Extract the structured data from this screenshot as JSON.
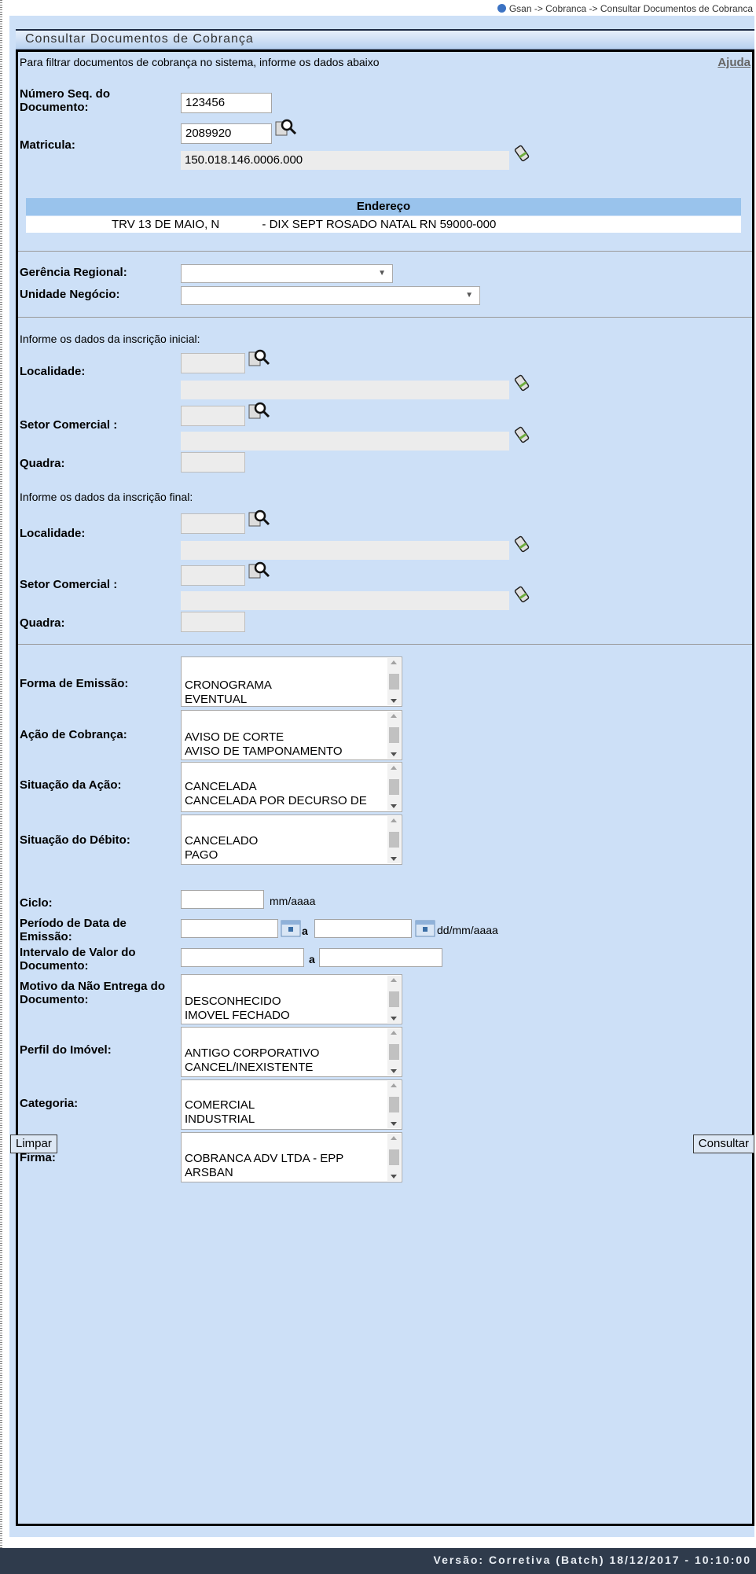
{
  "breadcrumb": "Gsan -> Cobranca -> Consultar Documentos de Cobranca",
  "title": "Consultar Documentos de Cobrança",
  "intro": "Para filtrar documentos de cobrança no sistema, informe os dados abaixo",
  "help_link": "Ajuda",
  "numero_seq": {
    "label": "Número Seq. do Documento:",
    "value": "123456"
  },
  "matricula": {
    "label": "Matricula:",
    "value": "2089920",
    "inscricao": "150.018.146.0006.000"
  },
  "endereco": {
    "header": "Endereço",
    "value": "TRV 13 DE MAIO, N             - DIX SEPT ROSADO NATAL RN 59000-000"
  },
  "gerencia_regional": {
    "label": "Gerência Regional:",
    "value": ""
  },
  "unidade_negocio": {
    "label": "Unidade Negócio:",
    "value": ""
  },
  "inscricao_inicial": {
    "heading": "Informe os dados da inscrição inicial:",
    "localidade_label": "Localidade:",
    "setor_label": "Setor Comercial :",
    "quadra_label": "Quadra:"
  },
  "inscricao_final": {
    "heading": "Informe os dados da inscrição final:",
    "localidade_label": "Localidade:",
    "setor_label": "Setor Comercial :",
    "quadra_label": "Quadra:"
  },
  "forma_emissao": {
    "label": "Forma de Emissão:",
    "options": [
      "CRONOGRAMA",
      "EVENTUAL"
    ]
  },
  "acao_cobranca": {
    "label": "Ação de Cobrança:",
    "options": [
      "AVISO DE CORTE",
      "AVISO DE TAMPONAMENTO"
    ]
  },
  "situacao_acao": {
    "label": "Situação da Ação:",
    "options": [
      "CANCELADA",
      "CANCELADA POR DECURSO DE"
    ]
  },
  "situacao_debito": {
    "label": "Situação do Débito:",
    "options": [
      "CANCELADO",
      "PAGO"
    ]
  },
  "ciclo": {
    "label": "Ciclo:",
    "hint": "mm/aaaa"
  },
  "periodo_emissao": {
    "label": "Período de Data de Emissão:",
    "sep": "a",
    "hint": "dd/mm/aaaa"
  },
  "intervalo_valor": {
    "label": "Intervalo de Valor do Documento:",
    "sep": "a"
  },
  "motivo_nao_entrega": {
    "label": "Motivo da Não Entrega do Documento:",
    "options": [
      "DESCONHECIDO",
      "IMOVEL FECHADO"
    ]
  },
  "perfil_imovel": {
    "label": "Perfil do Imóvel:",
    "options": [
      "ANTIGO CORPORATIVO",
      "CANCEL/INEXISTENTE"
    ]
  },
  "categoria": {
    "label": "Categoria:",
    "options": [
      "COMERCIAL",
      "INDUSTRIAL"
    ]
  },
  "firma": {
    "label": "Firma:",
    "options": [
      "COBRANCA ADV LTDA - EPP",
      "ARSBAN"
    ]
  },
  "buttons": {
    "limpar": "Limpar",
    "consultar": "Consultar"
  },
  "version": "Versão: Corretiva (Batch) 18/12/2017 - 10:10:00"
}
